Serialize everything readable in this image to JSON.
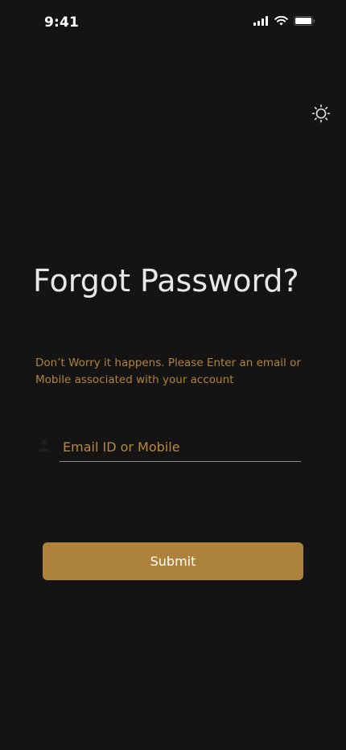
{
  "status_bar": {
    "time": "9:41",
    "icons": [
      "cellular-signal-icon",
      "wifi-icon",
      "battery-icon"
    ]
  },
  "theme_toggle": {
    "icon": "sun-icon"
  },
  "title": "Forgot Password?",
  "subtitle": "Don’t Worry it happens. Please Enter an email  or Mobile associated with your account",
  "form": {
    "identifier_placeholder": "Email ID or Mobile",
    "identifier_value": "",
    "identifier_icon": "user-icon",
    "submit_label": "Submit"
  },
  "colors": {
    "background": "#141414",
    "accent": "#ad823b",
    "accent_text": "#b0823a",
    "title_text": "#e8e8e8",
    "underline": "#8a8a8a"
  }
}
